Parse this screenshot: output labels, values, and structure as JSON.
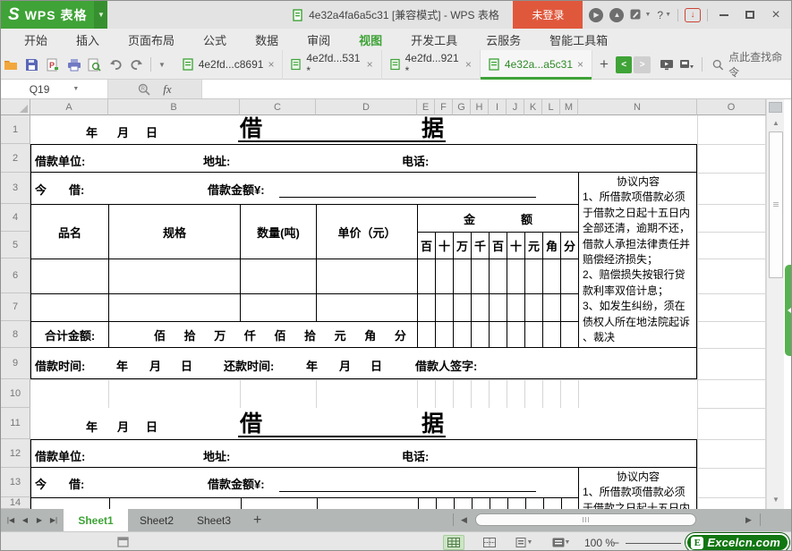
{
  "titlebar": {
    "logo_glyph": "S",
    "app_name": "WPS 表格",
    "document_title": "4e32a4fa6a5c31 [兼容模式] - WPS 表格",
    "login_label": "未登录",
    "help_label": "?"
  },
  "menubar": {
    "items": [
      "开始",
      "插入",
      "页面布局",
      "公式",
      "数据",
      "审阅",
      "视图",
      "开发工具",
      "云服务",
      "智能工具箱"
    ],
    "active_item": "视图"
  },
  "toolbar": {
    "file_tabs": [
      {
        "label": "4e2fd...c8691",
        "close": "×"
      },
      {
        "label": "4e2fd...531 *",
        "close": "×"
      },
      {
        "label": "4e2fd...921 *",
        "close": "×"
      },
      {
        "label": "4e32a...a5c31",
        "close": "×"
      }
    ],
    "new_tab_label": "+",
    "back_label": "<",
    "forward_label": ">",
    "search_placeholder": "点此查找命令"
  },
  "formula_bar": {
    "cell_reference": "Q19",
    "fx_label": "fx"
  },
  "sheet": {
    "column_headers": [
      "A",
      "B",
      "C",
      "D",
      "E",
      "F",
      "G",
      "H",
      "I",
      "J",
      "K",
      "L",
      "M",
      "N",
      "O"
    ],
    "row_headers": [
      "1",
      "2",
      "3",
      "4",
      "5",
      "6",
      "7",
      "8",
      "9",
      "10",
      "11",
      "12",
      "13",
      "14"
    ],
    "form": {
      "date_year": "年",
      "date_month": "月",
      "date_day": "日",
      "title_first_char": "借",
      "title_second_char": "据",
      "borrow_unit_label": "借款单位:",
      "address_label": "地址:",
      "phone_label": "电话:",
      "now_label": "今",
      "borrow_label": "借:",
      "amount_label": "借款金额¥:",
      "table": {
        "product_header": "品名",
        "spec_header": "规格",
        "quantity_header": "数量(吨)",
        "unit_price_header": "单价（元）",
        "amount_char_1": "金",
        "amount_char_2": "额",
        "digit_columns": [
          "百",
          "十",
          "万",
          "千",
          "百",
          "十",
          "元",
          "角",
          "分"
        ],
        "total_label": "合计金额:",
        "total_digits": [
          "佰",
          "拾",
          "万",
          "仟",
          "佰",
          "拾",
          "元",
          "角",
          "分"
        ]
      },
      "agreement": {
        "title": "协议内容",
        "lines": [
          "1、所借款项借款必须",
          "于借款之日起十五日内",
          "全部还清，逾期不还，",
          "借款人承担法律责任并",
          "赔偿经济损失；",
          "2、赔偿损失按银行贷",
          "款利率双倍计息；",
          "3、如发生纠纷，须在",
          "债权人所在地法院起诉",
          "、裁决"
        ]
      },
      "loan_date_label": "借款时间:",
      "repay_date_label": "还款时间:",
      "signature_label": "借款人签字:"
    }
  },
  "sheet_tabs": {
    "tabs": [
      "Sheet1",
      "Sheet2",
      "Sheet3"
    ],
    "active_tab": "Sheet1",
    "add_label": "+"
  },
  "status_bar": {
    "zoom_level": "100 %",
    "zoom_minus": "−"
  },
  "watermark": {
    "badge": "E",
    "text": "Excelcn.com"
  },
  "colors": {
    "wps_green": "#3fa337",
    "login_red": "#e0583c"
  }
}
